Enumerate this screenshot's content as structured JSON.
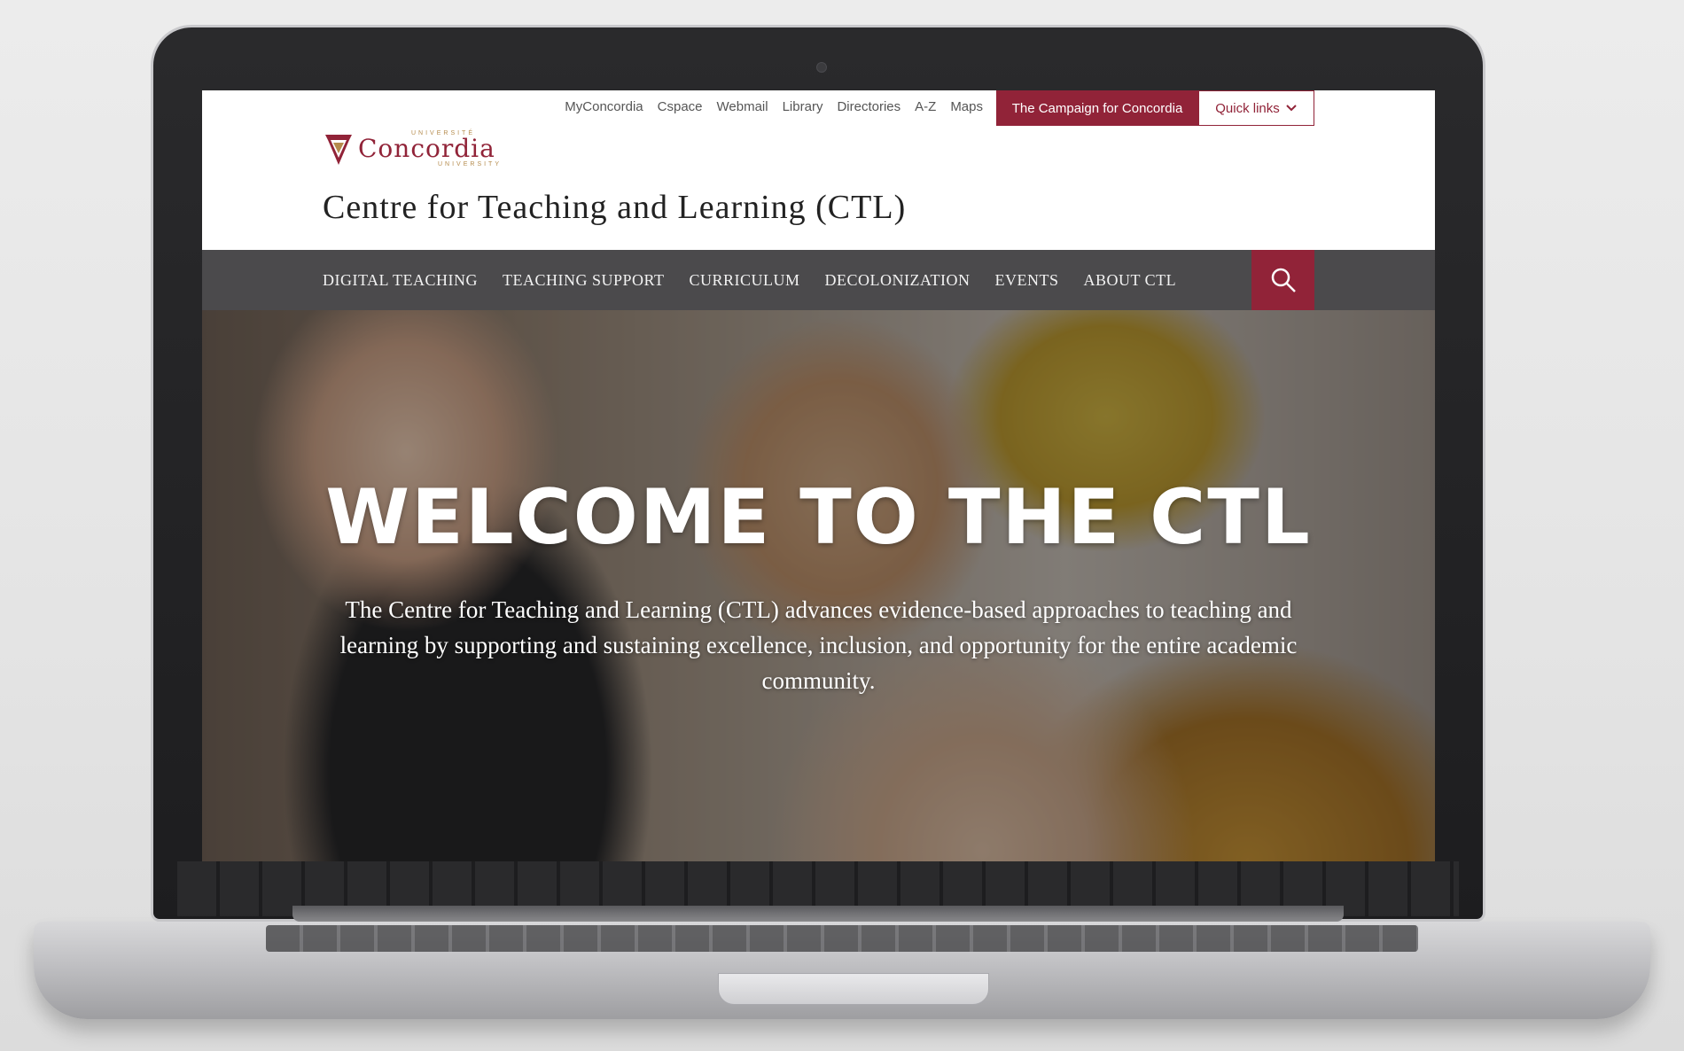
{
  "utility_links": [
    "MyConcordia",
    "Cspace",
    "Webmail",
    "Library",
    "Directories",
    "A-Z",
    "Maps"
  ],
  "campaign_label": "The Campaign for Concordia",
  "quick_links_label": "Quick links",
  "logo": {
    "top_text": "UNIVERSITÉ",
    "word": "Concordia",
    "bottom_text": "UNIVERSITY"
  },
  "site_title": "Centre for Teaching and Learning (CTL)",
  "nav_items": [
    "DIGITAL TEACHING",
    "TEACHING SUPPORT",
    "CURRICULUM",
    "DECOLONIZATION",
    "EVENTS",
    "ABOUT CTL"
  ],
  "hero": {
    "title": "WELCOME TO THE CTL",
    "text": "The Centre for Teaching and Learning (CTL) advances evidence-based approaches to teaching and learning by supporting and sustaining excellence, inclusion, and opportunity for the entire academic community."
  },
  "colors": {
    "brand": "#912338",
    "nav_bg": "#4b4a4c",
    "accent_gold": "#b58b4c"
  }
}
